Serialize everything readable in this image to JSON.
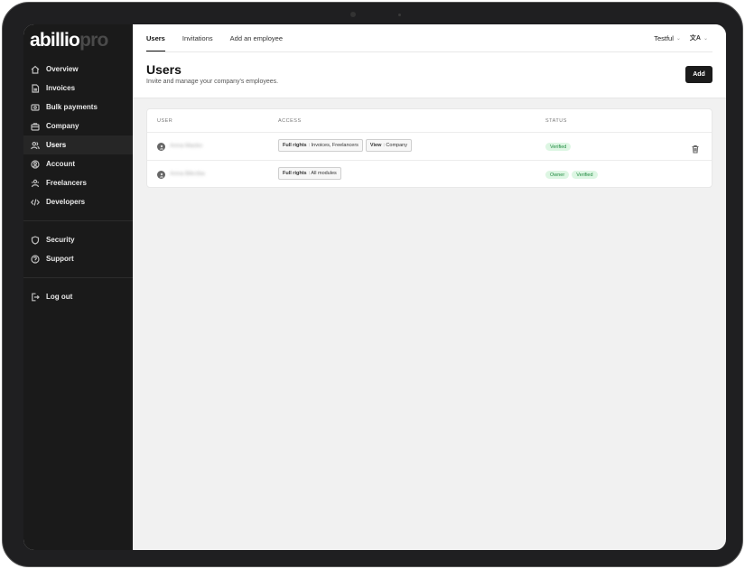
{
  "brand": {
    "name": "abillio",
    "suffix": "pro"
  },
  "sidebar": {
    "items": [
      {
        "label": "Overview",
        "icon": "home-icon"
      },
      {
        "label": "Invoices",
        "icon": "document-icon"
      },
      {
        "label": "Bulk payments",
        "icon": "payments-icon"
      },
      {
        "label": "Company",
        "icon": "briefcase-icon"
      },
      {
        "label": "Users",
        "icon": "users-icon",
        "active": true
      },
      {
        "label": "Account",
        "icon": "account-icon"
      },
      {
        "label": "Freelancers",
        "icon": "freelancers-icon"
      },
      {
        "label": "Developers",
        "icon": "code-icon"
      }
    ],
    "secondary": [
      {
        "label": "Security",
        "icon": "shield-icon"
      },
      {
        "label": "Support",
        "icon": "help-icon"
      }
    ],
    "logout": {
      "label": "Log out",
      "icon": "logout-icon"
    }
  },
  "tabs": [
    {
      "label": "Users",
      "active": true
    },
    {
      "label": "Invitations"
    },
    {
      "label": "Add an employee"
    }
  ],
  "header": {
    "company": "Testful",
    "language_icon": "translate-icon",
    "title": "Users",
    "subtitle": "Invite and manage your company's employees.",
    "add_label": "Add"
  },
  "table": {
    "columns": {
      "user": "USER",
      "access": "ACCESS",
      "status": "STATUS"
    },
    "rows": [
      {
        "name": "Anna Macko",
        "access": [
          {
            "level": "Full rights",
            "scope": ": Invoices, Freelancers"
          },
          {
            "level": "View",
            "scope": ": Company"
          }
        ],
        "status": [
          "Verified"
        ]
      },
      {
        "name": "Anna Bikrzba",
        "access": [
          {
            "level": "Full rights",
            "scope": ": All modules"
          }
        ],
        "status": [
          "Owner",
          "Verified"
        ]
      }
    ]
  }
}
